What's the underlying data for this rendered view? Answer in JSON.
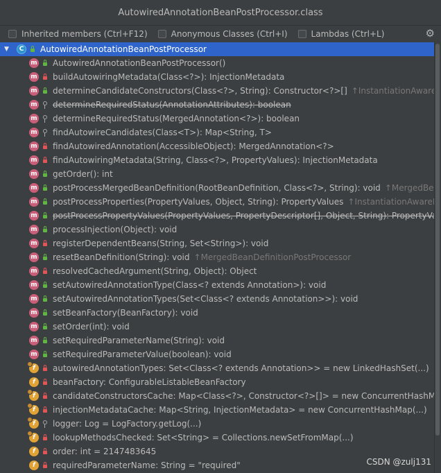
{
  "window": {
    "title": "AutowiredAnnotationBeanPostProcessor.class"
  },
  "options": [
    {
      "label": "Inherited members (Ctrl+F12)"
    },
    {
      "label": "Anonymous Classes (Ctrl+I)"
    },
    {
      "label": "Lambdas (Ctrl+L)"
    }
  ],
  "gear_icon": "gear-icon",
  "root": {
    "label": "AutowiredAnnotationBeanPostProcessor",
    "icon": "C"
  },
  "members": [
    {
      "kind": "m",
      "vis": "pub",
      "text": "AutowiredAnnotationBeanPostProcessor()",
      "inherited": ""
    },
    {
      "kind": "m",
      "vis": "priv",
      "text": "buildAutowiringMetadata(Class<?>): InjectionMetadata",
      "inherited": ""
    },
    {
      "kind": "m",
      "vis": "pub",
      "text": "determineCandidateConstructors(Class<?>, String): Constructor<?>[]",
      "inherited": "↑InstantiationAwareBeanP"
    },
    {
      "kind": "m",
      "vis": "pkg",
      "text": "determineRequiredStatus(AnnotationAttributes): boolean",
      "inherited": "",
      "deprecated": true
    },
    {
      "kind": "m",
      "vis": "pkg",
      "text": "determineRequiredStatus(MergedAnnotation<?>): boolean",
      "inherited": ""
    },
    {
      "kind": "m",
      "vis": "pkg",
      "text": "findAutowireCandidates(Class<T>): Map<String, T>",
      "inherited": ""
    },
    {
      "kind": "m",
      "vis": "priv",
      "text": "findAutowiredAnnotation(AccessibleObject): MergedAnnotation<?>",
      "inherited": ""
    },
    {
      "kind": "m",
      "vis": "priv",
      "text": "findAutowiringMetadata(String, Class<?>, PropertyValues): InjectionMetadata",
      "inherited": ""
    },
    {
      "kind": "m",
      "vis": "pub",
      "text": "getOrder(): int",
      "inherited": ""
    },
    {
      "kind": "m",
      "vis": "pub",
      "text": "postProcessMergedBeanDefinition(RootBeanDefinition, Class<?>, String): void",
      "inherited": "↑MergedBeanDe"
    },
    {
      "kind": "m",
      "vis": "pub",
      "text": "postProcessProperties(PropertyValues, Object, String): PropertyValues",
      "inherited": "↑InstantiationAwareBean"
    },
    {
      "kind": "m",
      "vis": "pub",
      "text": "postProcessPropertyValues(PropertyValues, PropertyDescriptor[], Object, String): PropertyValue",
      "inherited": "",
      "deprecated": true
    },
    {
      "kind": "m",
      "vis": "pub",
      "text": "processInjection(Object): void",
      "inherited": ""
    },
    {
      "kind": "m",
      "vis": "priv",
      "text": "registerDependentBeans(String, Set<String>): void",
      "inherited": ""
    },
    {
      "kind": "m",
      "vis": "pub",
      "text": "resetBeanDefinition(String): void",
      "inherited": "↑MergedBeanDefinitionPostProcessor"
    },
    {
      "kind": "m",
      "vis": "priv",
      "text": "resolvedCachedArgument(String, Object): Object",
      "inherited": ""
    },
    {
      "kind": "m",
      "vis": "pub",
      "text": "setAutowiredAnnotationType(Class<? extends Annotation>): void",
      "inherited": ""
    },
    {
      "kind": "m",
      "vis": "pub",
      "text": "setAutowiredAnnotationTypes(Set<Class<? extends Annotation>>): void",
      "inherited": ""
    },
    {
      "kind": "m",
      "vis": "pub",
      "text": "setBeanFactory(BeanFactory): void",
      "inherited": ""
    },
    {
      "kind": "m",
      "vis": "pub",
      "text": "setOrder(int): void",
      "inherited": ""
    },
    {
      "kind": "m",
      "vis": "pub",
      "text": "setRequiredParameterName(String): void",
      "inherited": ""
    },
    {
      "kind": "m",
      "vis": "pub",
      "text": "setRequiredParameterValue(boolean): void",
      "inherited": ""
    },
    {
      "kind": "f",
      "vis": "priv",
      "text": "autowiredAnnotationTypes: Set<Class<? extends Annotation>> = new LinkedHashSet(...)",
      "inherited": "",
      "final": true
    },
    {
      "kind": "f",
      "vis": "priv",
      "text": "beanFactory: ConfigurableListableBeanFactory",
      "inherited": ""
    },
    {
      "kind": "f",
      "vis": "priv",
      "text": "candidateConstructorsCache: Map<Class<?>, Constructor<?>[]> = new ConcurrentHashMap(...)",
      "inherited": "",
      "final": true
    },
    {
      "kind": "f",
      "vis": "priv",
      "text": "injectionMetadataCache: Map<String, InjectionMetadata> = new ConcurrentHashMap(...)",
      "inherited": "",
      "final": true
    },
    {
      "kind": "f",
      "vis": "pkg",
      "text": "logger: Log = LogFactory.getLog(...)",
      "inherited": "",
      "final": true
    },
    {
      "kind": "f",
      "vis": "priv",
      "text": "lookupMethodsChecked: Set<String> = Collections.newSetFromMap(...)",
      "inherited": "",
      "final": true
    },
    {
      "kind": "f",
      "vis": "priv",
      "text": "order: int = 2147483645",
      "inherited": ""
    },
    {
      "kind": "f",
      "vis": "priv",
      "text": "requiredParameterName: String = \"required\"",
      "inherited": ""
    }
  ],
  "watermark": "CSDN @zulj131"
}
